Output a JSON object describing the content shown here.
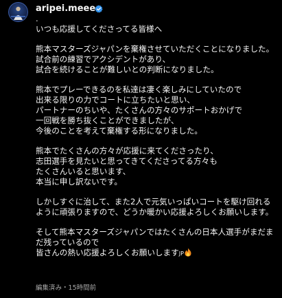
{
  "post": {
    "username": "aripei.meee",
    "verified": true,
    "leading_dot": ".",
    "paragraphs": [
      "いつも応援してくださってる皆様へ",
      "熊本マスターズジャパンを棄権させていただくことになりました。\n試合前の練習でアクシデントがあり、\n試合を続けることが難しいとの判断になりました。",
      "熊本でプレーできるのを私達は凄く楽しみにしていたので\n出来る限りの力でコートに立ちたいと思い、\nパートナーのちいや、たくさんの方々のサポートおかげで\n一回戦を勝ち抜くことができましたが、\n今後のことを考えて棄権する形になりました。",
      "熊本でたくさんの方々が応援に来てくださったり、\n志田選手を見たいと思ってきてくださってる方々も\nたくさんいると思います、\n本当に申し訳ないです。",
      "しかしすぐに治して、また2人で元気いっぱいコートを駆け回れるように頑張りますので、どうか暖かい応援よろしくお願いします。",
      "そして熊本マスターズジャパンではたくさんの日本人選手がまだまだ残っているので\n皆さんの熱い応援よろしくお願いします"
    ],
    "flag_text": "JP",
    "edited_label": "編集済み",
    "separator": "・",
    "time_ago": "15時間前",
    "colors": {
      "background": "#000000",
      "text": "#f5f5f5",
      "meta": "#a8a8a8",
      "verified": "#3797f0"
    },
    "icons": {
      "verified": "verified-badge-icon",
      "flag": "japan-flag-icon",
      "fire": "fire-icon"
    }
  }
}
